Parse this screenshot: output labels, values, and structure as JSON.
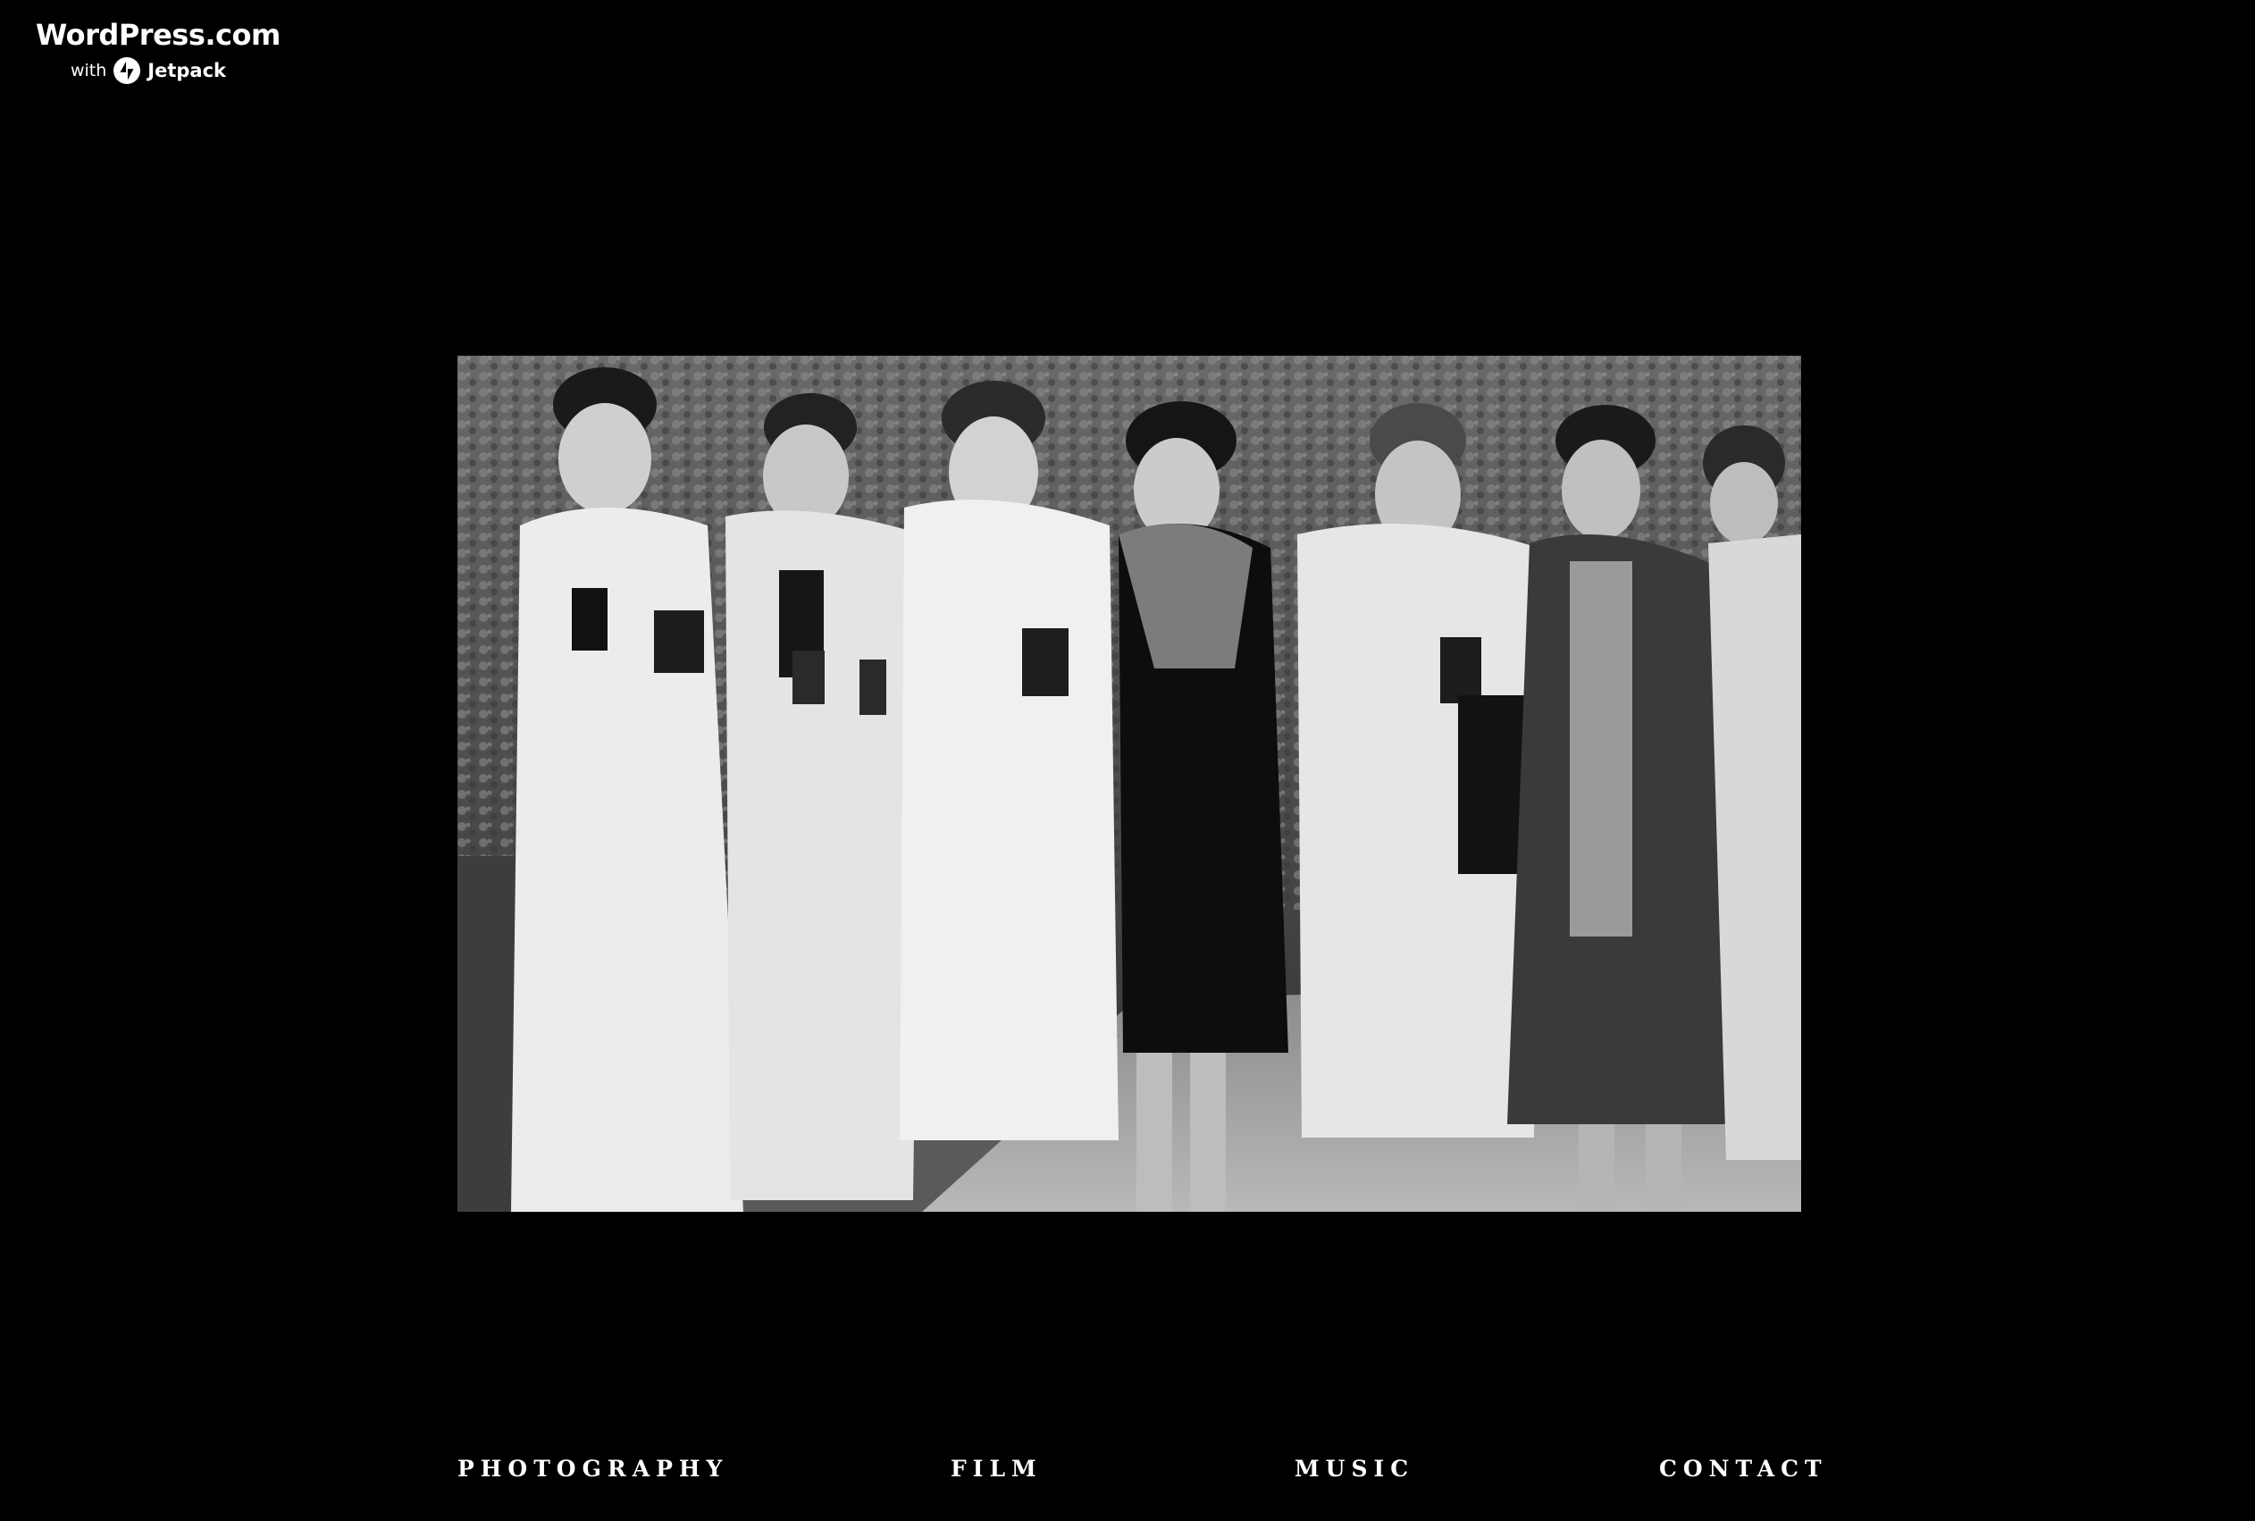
{
  "brand": {
    "name": "WordPress.com",
    "with": "with",
    "jetpack": "Jetpack",
    "icon": "jetpack-bolt-icon"
  },
  "photo": {
    "description_kind": "black-and-white photograph",
    "icon": "photograph"
  },
  "nav": {
    "items": [
      {
        "label": "PHOTOGRAPHY"
      },
      {
        "label": "FILM"
      },
      {
        "label": "MUSIC"
      },
      {
        "label": "CONTACT"
      }
    ]
  },
  "colors": {
    "background": "#000000",
    "text": "#ffffff"
  }
}
